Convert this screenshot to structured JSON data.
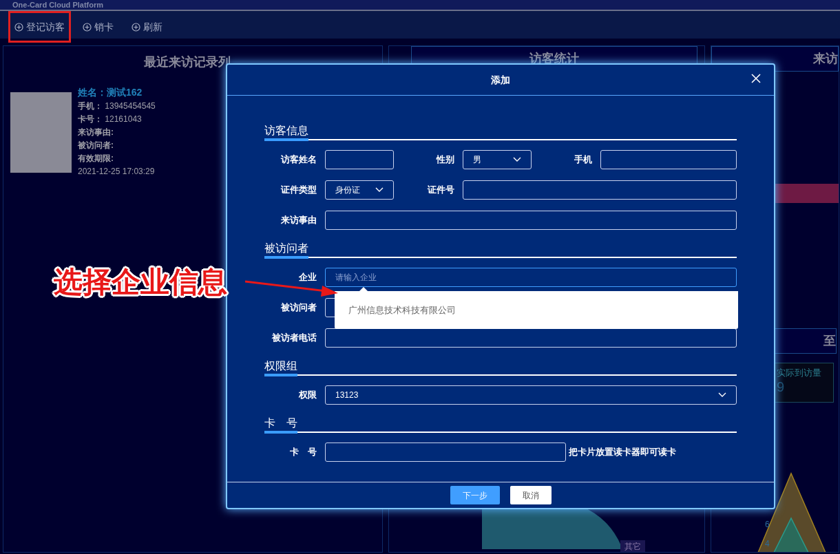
{
  "header": {
    "title": "One-Card Cloud Platform"
  },
  "toolbar": [
    {
      "label": "登记访客",
      "highlighted": true
    },
    {
      "label": "销卡",
      "highlighted": false
    },
    {
      "label": "刷新",
      "highlighted": false
    }
  ],
  "recent_visits": {
    "title": "最近来访记录列",
    "records": [
      {
        "name": "姓名：测试162",
        "fields": [
          {
            "label": "手机：",
            "value": "13945454545"
          },
          {
            "label": "卡号：",
            "value": "12161043"
          },
          {
            "label": "来访事由:"
          },
          {
            "label": "被访问者:"
          },
          {
            "label": "有效期限:"
          }
        ],
        "time": "2021-12-25 17:03:29"
      }
    ]
  },
  "visitor_stats": {
    "title": "访客统计",
    "pie_label": "其它"
  },
  "right_panel": {
    "title": "来访",
    "lower_title": "至",
    "stat": {
      "label": "实际到访量",
      "value": "9"
    },
    "chart_ticks": [
      "6",
      "4"
    ]
  },
  "modal": {
    "title": "添加",
    "sections": [
      {
        "title": "访客信息",
        "rows": [
          [
            {
              "label": "访客姓名",
              "kind": "input"
            },
            {
              "label": "性别",
              "kind": "select",
              "value": "男"
            },
            {
              "label": "手机",
              "kind": "input"
            }
          ],
          [
            {
              "label": "证件类型",
              "kind": "select",
              "value": "身份证"
            },
            {
              "label": "证件号",
              "kind": "input"
            }
          ],
          [
            {
              "label": "来访事由",
              "kind": "input"
            }
          ]
        ]
      },
      {
        "title": "被访问者",
        "rows": [
          [
            {
              "label": "企业",
              "kind": "input",
              "placeholder": "请输入企业",
              "focused": true
            }
          ],
          [
            {
              "label": "被访问者",
              "kind": "input"
            }
          ],
          [
            {
              "label": "被访者电话",
              "kind": "input"
            }
          ]
        ]
      },
      {
        "title": "权限组",
        "rows": [
          [
            {
              "label": "权限",
              "kind": "select",
              "value": "13123"
            }
          ]
        ]
      },
      {
        "title": "卡　号",
        "rows": [
          [
            {
              "label": "卡　号",
              "kind": "input",
              "hint": "把卡片放置读卡器即可读卡"
            }
          ]
        ]
      }
    ],
    "dropdown": {
      "options": [
        "广州信息技术科技有限公司"
      ]
    },
    "buttons": [
      {
        "label": "下一步",
        "kind": "primary"
      },
      {
        "label": "取消",
        "kind": "default"
      }
    ]
  },
  "annotation": {
    "text": "选择企业信息"
  }
}
